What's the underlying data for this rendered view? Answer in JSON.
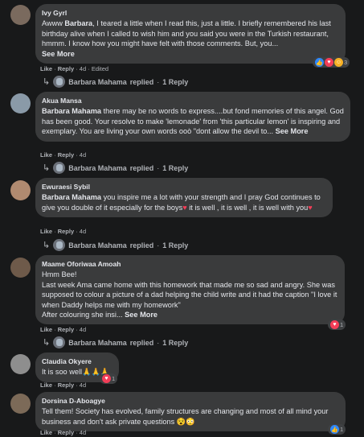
{
  "reply_prefix": "replied",
  "comments": [
    {
      "author": "Ivy Gyrl",
      "mention": "Barbara",
      "pre": "Awww ",
      "text": ", I teared a little when I read this, just a little. I briefly remembered his last birthday alive when I called to wish him and you said you were in the Turkish restaurant, hmmm. I know how you might have felt with those comments. But, you...",
      "see_more": "See More",
      "like": "Like",
      "reply": "Reply",
      "time": "4d",
      "edited": "Edited",
      "reaction_count": "3",
      "replier": "Barbara Mahama",
      "replies": "1 Reply"
    },
    {
      "author": "Akua Mansa",
      "mention": "Barbara Mahama",
      "text": " there may be no words to express....but fond memories of this angel. God has been good. Your resolve to make 'lemonade' from 'this particular lemon' is inspiring and exemplary. You are living your own words ooò \"dont allow the devil to...",
      "see_more": "See More",
      "like": "Like",
      "reply": "Reply",
      "time": "4d",
      "replier": "Barbara Mahama",
      "replies": "1 Reply"
    },
    {
      "author": "Ewuraesi Sybil",
      "mention": "Barbara Mahama",
      "text": " you inspire me a lot with your strength and I pray God continues to give you double of it especially for the boys",
      "text2": " it is well , it is well , it is well with you",
      "like": "Like",
      "reply": "Reply",
      "time": "4d",
      "replier": "Barbara Mahama",
      "replies": "1 Reply"
    },
    {
      "author": "Maame Oforiwaa Amoah",
      "line1": "Hmm Bee!",
      "line2": "Last week Ama came home with this homework that made me so sad and angry. She was supposed to colour a picture of a dad helping the child write and it had the caption \"I love it when Daddy helps me with my homework\"",
      "line3": "After colouring she insi...",
      "see_more": "See More",
      "like": "Like",
      "reply": "Reply",
      "time": "4d",
      "reaction_count": "1",
      "replier": "Barbara Mahama",
      "replies": "1 Reply"
    },
    {
      "author": "Claudia Okyere",
      "text": "It is soo well",
      "emoji": "🙏🙏🙏",
      "like": "Like",
      "reply": "Reply",
      "time": "4d",
      "reaction_count": "1"
    },
    {
      "author": "Dorsina D-Aboagye",
      "text": "Tell them! Society has evolved, family structures are changing and most of all mind your business and don't ask private questions ",
      "emoji": "😵😳",
      "like": "Like",
      "reply": "Reply",
      "time": "4d",
      "reaction_count": "1"
    }
  ]
}
